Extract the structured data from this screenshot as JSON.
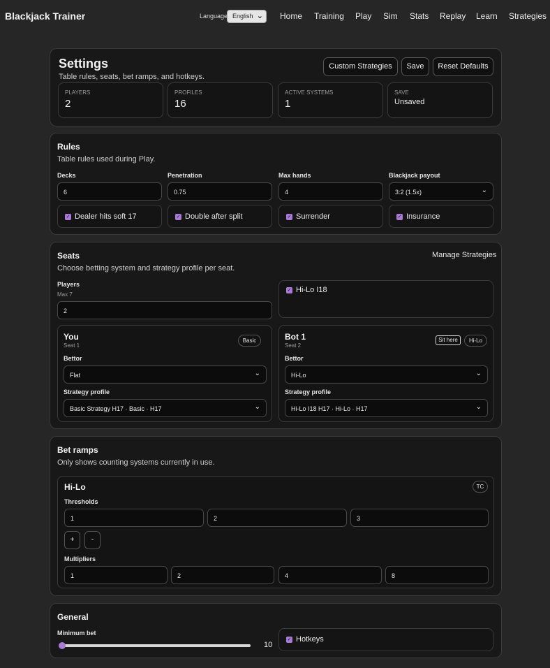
{
  "app": {
    "title": "Blackjack Trainer",
    "language_label": "Language",
    "language_value": "English",
    "nav": [
      "Home",
      "Training",
      "Play",
      "Sim",
      "Stats",
      "Replay",
      "Learn",
      "Strategies"
    ]
  },
  "settings": {
    "title": "Settings",
    "subtitle": "Table rules, seats, bet ramps, and hotkeys.",
    "buttons": {
      "custom": "Custom Strategies",
      "save": "Save",
      "reset": "Reset Defaults"
    },
    "stats": [
      {
        "label": "Players",
        "value": "2"
      },
      {
        "label": "Profiles",
        "value": "16"
      },
      {
        "label": "Active systems",
        "value": "1"
      },
      {
        "label": "Save",
        "value": "Unsaved"
      }
    ]
  },
  "rules": {
    "title": "Rules",
    "subtitle": "Table rules used during Play.",
    "decks_label": "Decks",
    "decks_value": "6",
    "penetration_label": "Penetration",
    "penetration_value": "0.75",
    "maxhands_label": "Max hands",
    "maxhands_value": "4",
    "payout_label": "Blackjack payout",
    "payout_value": "3:2 (1.5x)",
    "checks": [
      {
        "label": "Dealer hits soft 17",
        "checked": true
      },
      {
        "label": "Double after split",
        "checked": true
      },
      {
        "label": "Surrender",
        "checked": true
      },
      {
        "label": "Insurance",
        "checked": true
      }
    ]
  },
  "seats": {
    "title": "Seats",
    "subtitle": "Choose betting system and strategy profile per seat.",
    "manage_link": "Manage Strategies",
    "players_label": "Players",
    "players_hint": "Max 7",
    "players_value": "2",
    "extra_check": "Hi-Lo I18",
    "seat_list": [
      {
        "name": "You",
        "seat": "Seat 1",
        "badge": "Basic",
        "bettor_label": "Bettor",
        "bettor_value": "Flat",
        "strategy_label": "Strategy profile",
        "strategy_value": "Basic Strategy H17 · Basic · H17"
      },
      {
        "name": "Bot 1",
        "seat": "Seat 2",
        "badge": "Hi-Lo",
        "sit_here": "Sit here",
        "bettor_label": "Bettor",
        "bettor_value": "Hi-Lo",
        "strategy_label": "Strategy profile",
        "strategy_value": "Hi-Lo I18 H17 · Hi-Lo · H17"
      }
    ]
  },
  "bet_ramps": {
    "title": "Bet ramps",
    "subtitle": "Only shows counting systems currently in use.",
    "system": "Hi-Lo",
    "badge": "TC",
    "thresholds_label": "Thresholds",
    "thresholds": [
      "1",
      "2",
      "3"
    ],
    "add_label": "+",
    "remove_label": "-",
    "multipliers_label": "Multipliers",
    "multipliers": [
      "1",
      "2",
      "4",
      "8"
    ]
  },
  "general": {
    "title": "General",
    "min_bet_label": "Minimum bet",
    "min_bet_value": "10",
    "min_bet_fraction": 0.0,
    "hotkeys_label": "Hotkeys",
    "hotkeys_checked": true
  },
  "colors": {
    "accent": "#a77bd6",
    "background": "#262626",
    "card": "#181818"
  }
}
